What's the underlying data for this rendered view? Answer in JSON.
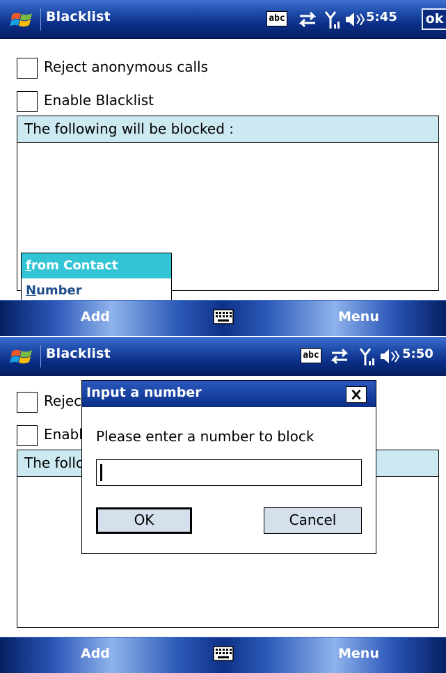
{
  "screens": [
    {
      "title": "Blacklist",
      "status": {
        "input_mode": "abc",
        "time": "5:45",
        "ok_label": "ok"
      },
      "options": [
        {
          "label": "Reject anonymous calls",
          "checked": false
        },
        {
          "label": "Enable Blacklist",
          "checked": false
        }
      ],
      "list_header": "The following will be blocked :",
      "popup_menu": [
        {
          "accel": "f",
          "rest": "rom Contact",
          "selected": true
        },
        {
          "accel": "N",
          "rest": "umber",
          "selected": false
        }
      ],
      "softkeys": {
        "left": "Add",
        "right": "Menu"
      }
    },
    {
      "title": "Blacklist",
      "status": {
        "input_mode": "abc",
        "time": "5:50"
      },
      "options": [
        {
          "label": "Reject anonymous calls",
          "checked": false
        },
        {
          "label": "Enable Blacklist",
          "checked": false
        }
      ],
      "list_header": "The following will be blocked :",
      "dialog": {
        "title": "Input a number",
        "prompt": "Please enter a number to block",
        "input_value": "",
        "ok_label": "OK",
        "cancel_label": "Cancel"
      },
      "softkeys": {
        "left": "Add",
        "right": "Menu"
      }
    }
  ],
  "icons": {
    "start": "windows-start-icon",
    "connectivity": "sync-arrows-icon",
    "signal": "signal-strength-icon",
    "volume": "speaker-icon",
    "keyboard": "keyboard-icon",
    "close": "close-icon"
  },
  "colors": {
    "title_bar": "#0b2e86",
    "list_header_bg": "#cce8f0",
    "menu_highlight": "#33c4d6",
    "button_bg": "#d4e0ec"
  }
}
